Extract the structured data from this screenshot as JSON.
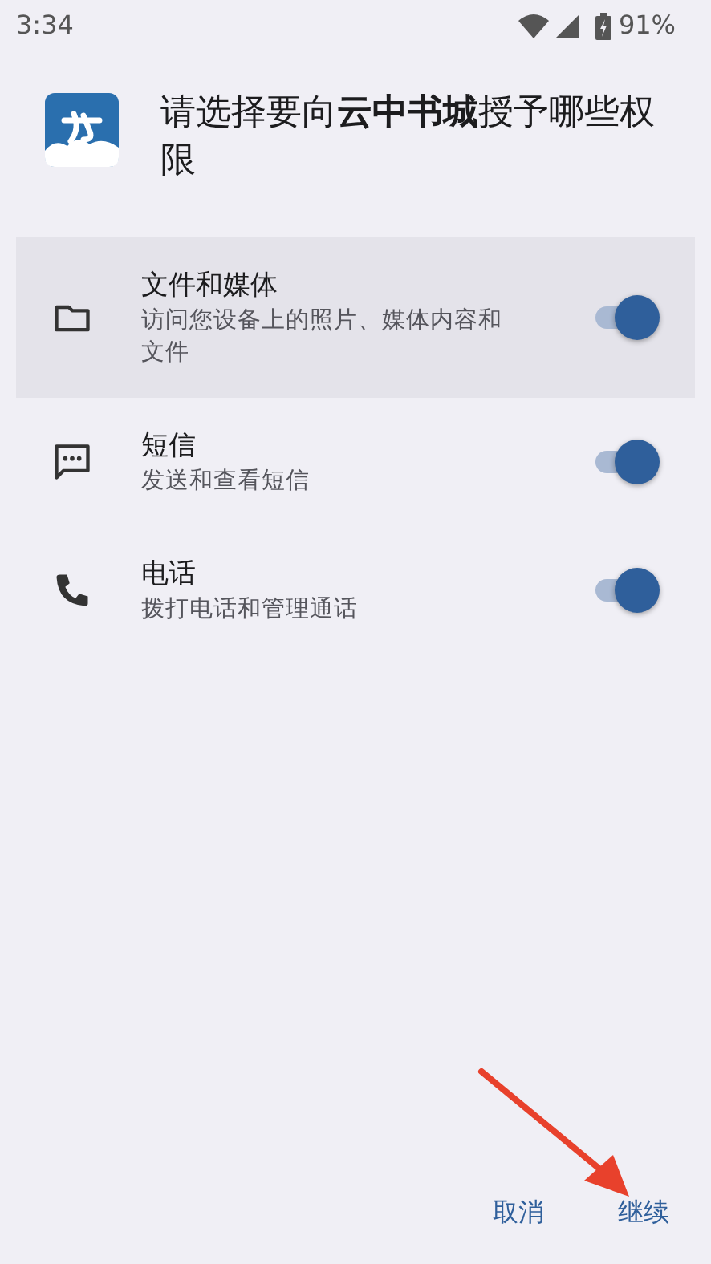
{
  "status_bar": {
    "time": "3:34",
    "battery": "91%"
  },
  "dialog": {
    "title": "请选择要向**云中书城**授予哪些权限"
  },
  "permissions": [
    {
      "kind": "folder",
      "label": "文件和媒体",
      "description": "访问您设备上的照片、媒体内容和文件",
      "on": true,
      "selected": true
    },
    {
      "kind": "message",
      "label": "短信",
      "description": "发送和查看短信",
      "on": true,
      "selected": false
    },
    {
      "kind": "phone",
      "label": "电话",
      "description": "拨打电话和管理通话",
      "on": true,
      "selected": false
    }
  ],
  "buttons": [
    {
      "label": "取消"
    },
    {
      "label": "继续"
    }
  ],
  "annotation": {
    "kind": "arrow"
  }
}
